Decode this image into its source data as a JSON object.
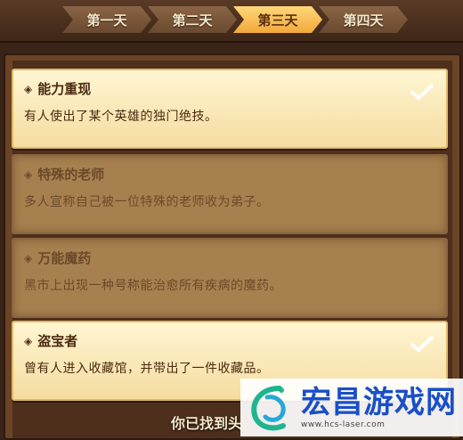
{
  "tabs": [
    {
      "label": "第一天",
      "active": false
    },
    {
      "label": "第二天",
      "active": false
    },
    {
      "label": "第三天",
      "active": true
    },
    {
      "label": "第四天",
      "active": false
    }
  ],
  "clues": [
    {
      "title": "能力重现",
      "desc": "有人使出了某个英雄的独门绝技。",
      "found": true
    },
    {
      "title": "特殊的老师",
      "desc": "多人宣称自己被一位特殊的老师收为弟子。",
      "found": false
    },
    {
      "title": "万能魔药",
      "desc": "黑市上出现一种号称能治愈所有疾病的魔药。",
      "found": false
    },
    {
      "title": "盗宝者",
      "desc": "曾有人进入收藏馆，并带出了一件收藏品。",
      "found": true
    }
  ],
  "footer": {
    "text": "你已找到头"
  },
  "watermark": {
    "name": "宏昌游戏网",
    "url": "www.hcs-laser.com"
  },
  "colors": {
    "active_tab": "#f2a93a",
    "card_on": "#fff6d2",
    "card_off": "#a7804f",
    "watermark_text": "#1a4fc7"
  }
}
